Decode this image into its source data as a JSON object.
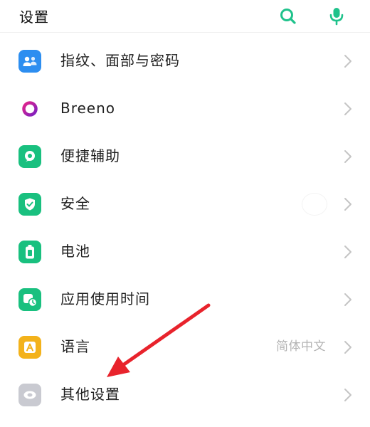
{
  "header": {
    "title": "设置",
    "search_icon": "search-icon",
    "mic_icon": "mic-icon",
    "accent": "#1fc28b"
  },
  "items": [
    {
      "label": "指纹、面部与密码",
      "value": "",
      "icon": "face-fingerprint-icon",
      "color": "#2d8ef0"
    },
    {
      "label": "Breeno",
      "value": "",
      "icon": "breeno-ring-icon",
      "color": "#b3159b"
    },
    {
      "label": "便捷辅助",
      "value": "",
      "icon": "assist-hand-icon",
      "color": "#19c07f"
    },
    {
      "label": "安全",
      "value": "",
      "icon": "shield-icon",
      "color": "#19c07f"
    },
    {
      "label": "电池",
      "value": "",
      "icon": "battery-icon",
      "color": "#19c07f"
    },
    {
      "label": "应用使用时间",
      "value": "",
      "icon": "app-time-icon",
      "color": "#19c07f"
    },
    {
      "label": "语言",
      "value": "简体中文",
      "icon": "language-icon",
      "color": "#f3b21b"
    },
    {
      "label": "其他设置",
      "value": "",
      "icon": "other-settings-icon",
      "color": "#c9cad1"
    }
  ],
  "annotation": {
    "icon": "red-arrow-annotation",
    "color": "#e8232c"
  }
}
